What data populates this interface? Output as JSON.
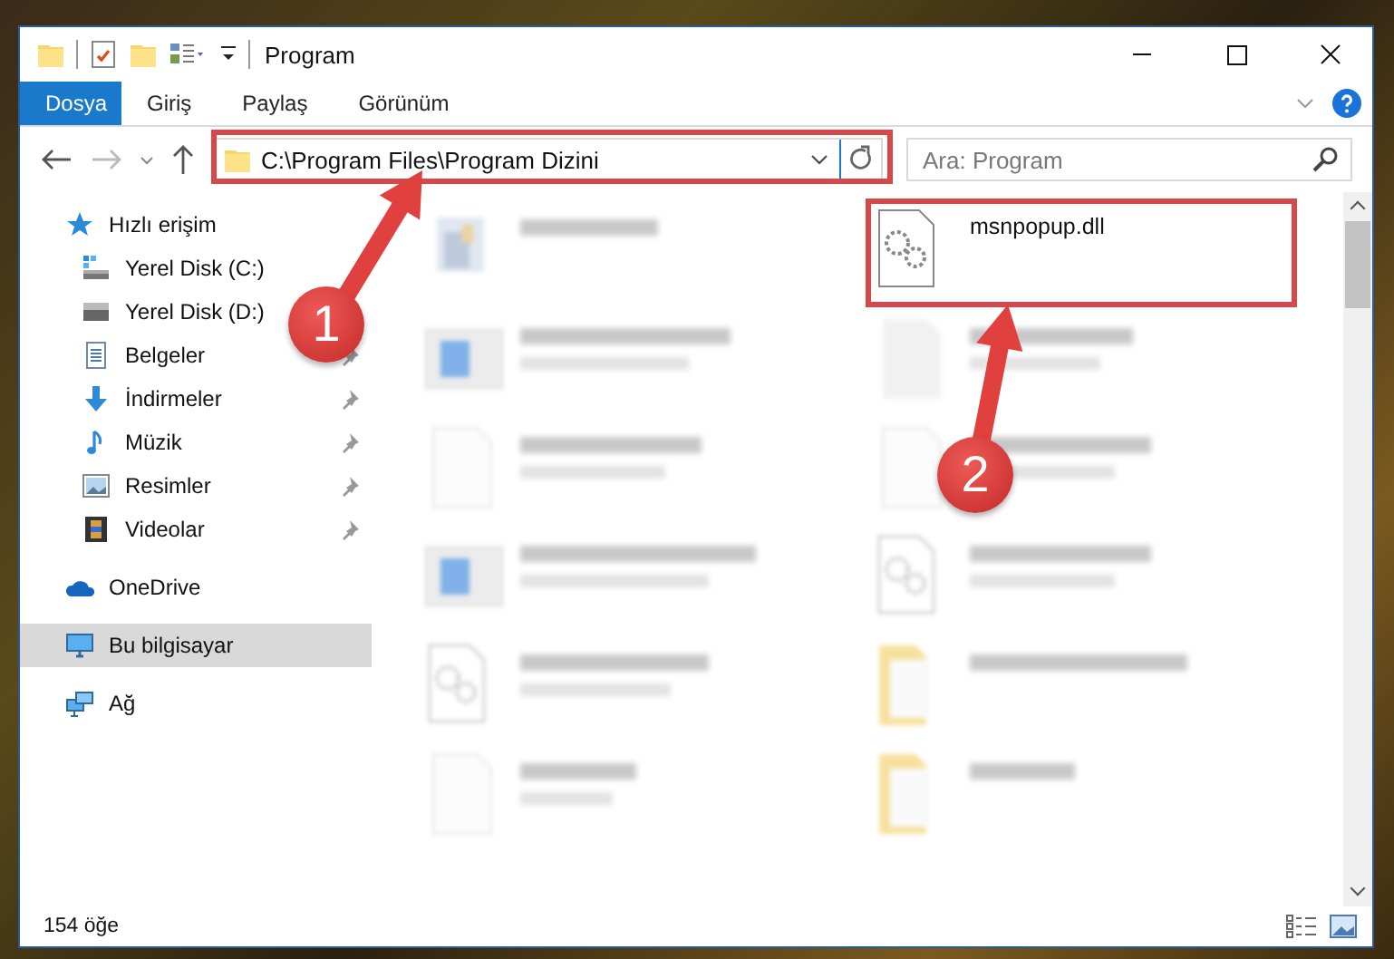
{
  "window": {
    "title": "Program"
  },
  "ribbon_tabs": [
    {
      "label": "Dosya",
      "kind": "file"
    },
    {
      "label": "Giriş",
      "kind": "tab"
    },
    {
      "label": "Paylaş",
      "kind": "tab"
    },
    {
      "label": "Görünüm",
      "kind": "tab"
    }
  ],
  "address_bar": {
    "path": "C:\\Program Files\\Program Dizini"
  },
  "search": {
    "placeholder": "Ara: Program"
  },
  "sidebar": {
    "items": [
      {
        "label": "Hızlı erişim",
        "pinned": false,
        "selected": false,
        "kind": "group"
      },
      {
        "label": "Yerel Disk (C:)",
        "pinned": false,
        "selected": false,
        "kind": "child"
      },
      {
        "label": "Yerel Disk (D:)",
        "pinned": false,
        "selected": false,
        "kind": "child"
      },
      {
        "label": "Belgeler",
        "pinned": true,
        "selected": false,
        "kind": "child"
      },
      {
        "label": "İndirmeler",
        "pinned": true,
        "selected": false,
        "kind": "child"
      },
      {
        "label": "Müzik",
        "pinned": true,
        "selected": false,
        "kind": "child"
      },
      {
        "label": "Resimler",
        "pinned": true,
        "selected": false,
        "kind": "child"
      },
      {
        "label": "Videolar",
        "pinned": true,
        "selected": false,
        "kind": "child"
      },
      {
        "label": "OneDrive",
        "pinned": false,
        "selected": false,
        "kind": "group"
      },
      {
        "label": "Bu bilgisayar",
        "pinned": false,
        "selected": true,
        "kind": "group"
      },
      {
        "label": "Ağ",
        "pinned": false,
        "selected": false,
        "kind": "group"
      }
    ]
  },
  "files": [
    {
      "kind": "exe",
      "blurred": true
    },
    {
      "name": "msnpopup.dll",
      "kind": "dll",
      "blurred": false
    },
    {
      "kind": "installer",
      "blurred": true
    },
    {
      "kind": "text",
      "blurred": true
    },
    {
      "kind": "doc",
      "blurred": true
    },
    {
      "kind": "doc",
      "blurred": true
    },
    {
      "kind": "installer",
      "blurred": true
    },
    {
      "kind": "dll",
      "blurred": true
    },
    {
      "kind": "dll",
      "blurred": true
    },
    {
      "kind": "folder",
      "blurred": true
    },
    {
      "kind": "doc",
      "blurred": true
    },
    {
      "kind": "folder",
      "blurred": true
    }
  ],
  "status_bar": {
    "count": "154 öğe"
  },
  "annotations": {
    "steps": [
      {
        "label": "1"
      },
      {
        "label": "2"
      }
    ]
  }
}
